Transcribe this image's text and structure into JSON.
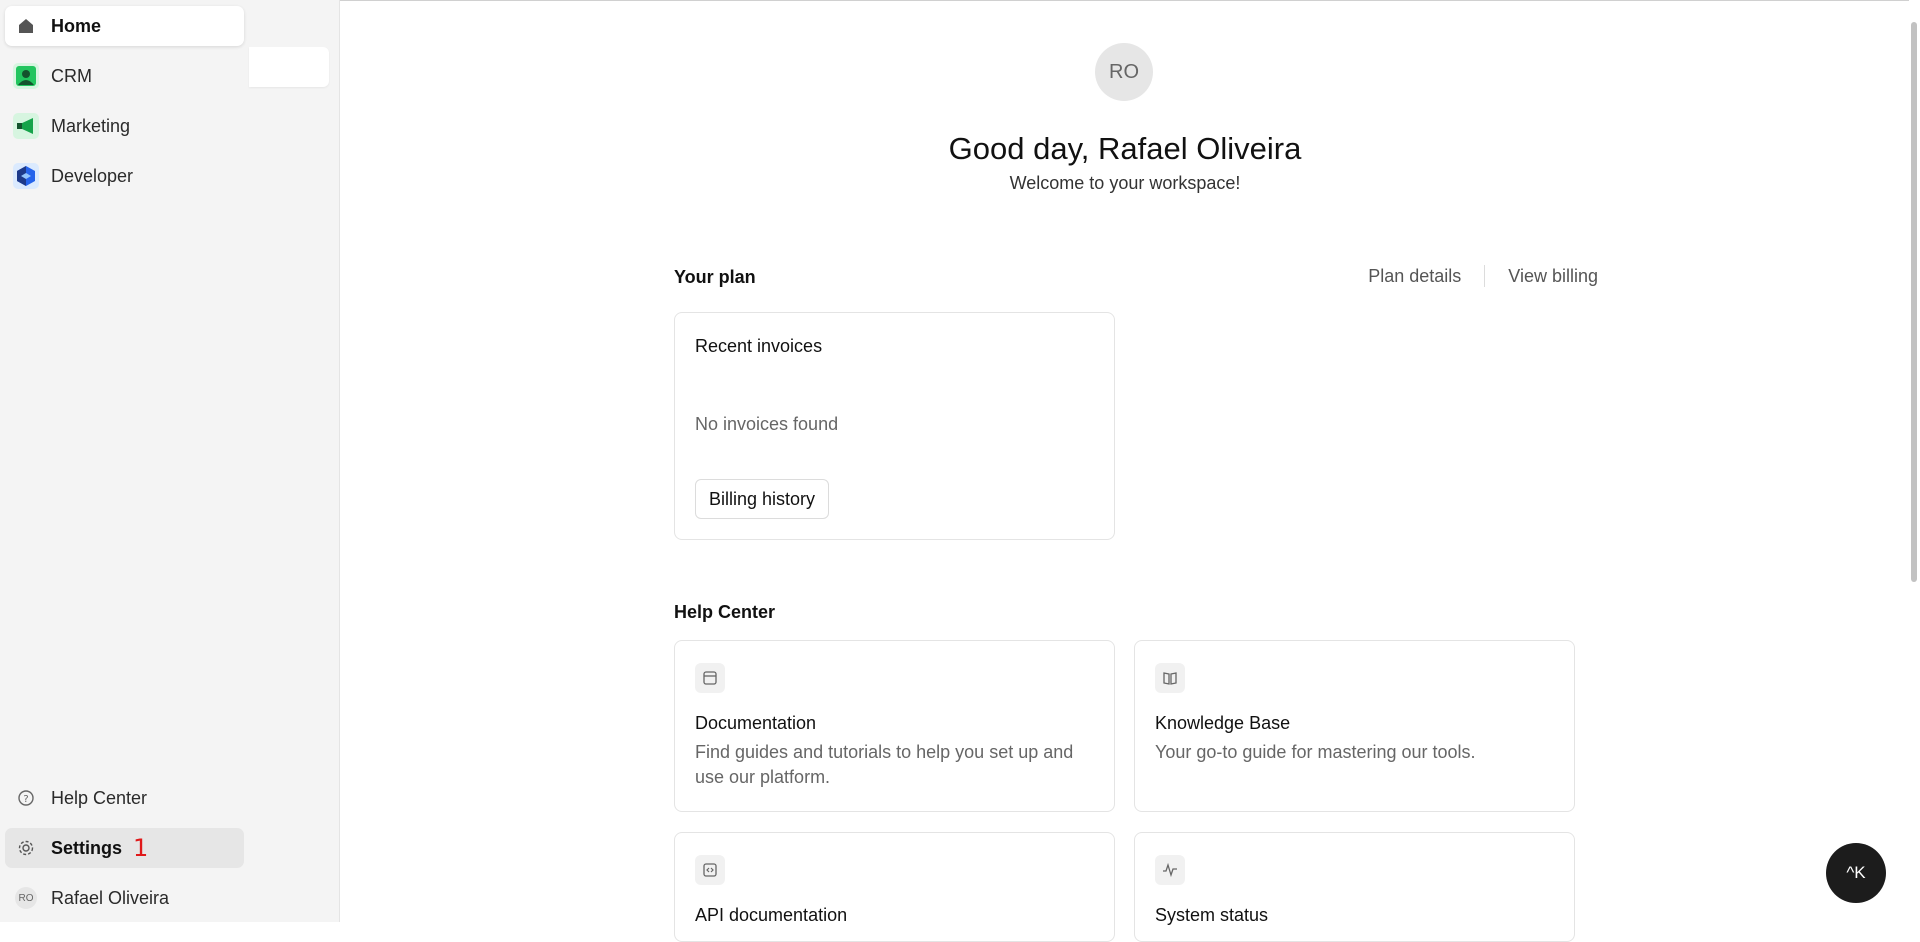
{
  "nav": {
    "items": [
      {
        "label": "Home",
        "icon": "home-icon"
      },
      {
        "label": "CRM",
        "icon": "crm-icon"
      },
      {
        "label": "Marketing",
        "icon": "marketing-icon"
      },
      {
        "label": "Developer",
        "icon": "developer-icon"
      }
    ],
    "bottom": {
      "help_label": "Help Center",
      "settings_label": "Settings",
      "settings_marker": "1",
      "user_initials": "RO",
      "user_name": "Rafael Oliveira"
    }
  },
  "main": {
    "avatar_initials": "RO",
    "greeting": "Good day, Rafael Oliveira",
    "welcome": "Welcome to your workspace!",
    "plan": {
      "title": "Your plan",
      "plan_details_link": "Plan details",
      "view_billing_link": "View billing",
      "invoices": {
        "title": "Recent invoices",
        "empty_text": "No invoices found",
        "button_label": "Billing history"
      }
    },
    "help_center": {
      "title": "Help Center",
      "cards": [
        {
          "title": "Documentation",
          "description": "Find guides and tutorials to help you set up and use our platform.",
          "icon": "document-icon"
        },
        {
          "title": "Knowledge Base",
          "description": "Your go-to guide for mastering our tools.",
          "icon": "book-icon"
        },
        {
          "title": "API documentation",
          "description": "",
          "icon": "code-icon"
        },
        {
          "title": "System status",
          "description": "",
          "icon": "activity-icon"
        }
      ]
    },
    "command_button": "^K"
  },
  "colors": {
    "accent_green": "#22c55e",
    "developer_blue": "#3b82f6",
    "marker_red": "#e0191a",
    "command_bg": "#1c1c1c"
  }
}
